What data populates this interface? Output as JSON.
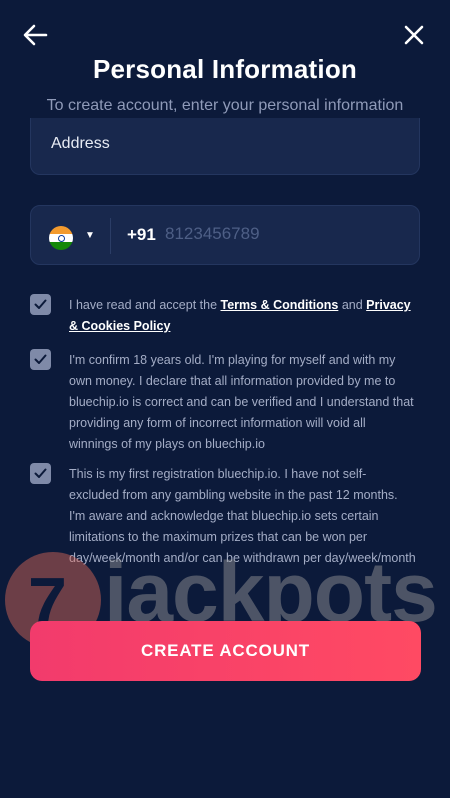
{
  "header": {
    "back_icon": "arrow-left-icon",
    "close_icon": "close-icon",
    "title": "Personal Information",
    "subtitle": "To create account, enter your personal information"
  },
  "form": {
    "address": {
      "placeholder": "Address",
      "value": ""
    },
    "phone": {
      "country_flag": "india-flag-icon",
      "dial_code": "+91",
      "placeholder": "8123456789",
      "value": ""
    }
  },
  "consents": [
    {
      "checked": true,
      "text_before": "I have read and accept the ",
      "link1": "Terms & Conditions",
      "text_middle": " and ",
      "link2": "Privacy & Cookies Policy"
    },
    {
      "checked": true,
      "text": "I'm confirm 18 years old. I'm playing for myself and with my own money. I declare that all information provided by me to bluechip.io is correct and can be verified and I understand that providing any form of incorrect information will void all winnings of my plays on bluechip.io"
    },
    {
      "checked": true,
      "text": "This is my first registration bluechip.io. I have not self-excluded from any gambling website in the past 12 months. I'm aware and acknowledge that bluechip.io sets certain limitations to the maximum prizes that can be won per day/week/month and/or can be withdrawn per day/week/month"
    }
  ],
  "cta": {
    "label": "CREATE ACCOUNT"
  },
  "watermark": {
    "symbol": "7",
    "text": "jackpots"
  },
  "colors": {
    "background": "#0c1a3a",
    "field": "#18284d",
    "checkbox": "#7f8aa8",
    "cta_start": "#f23b6c",
    "cta_end": "#ff4a63"
  }
}
